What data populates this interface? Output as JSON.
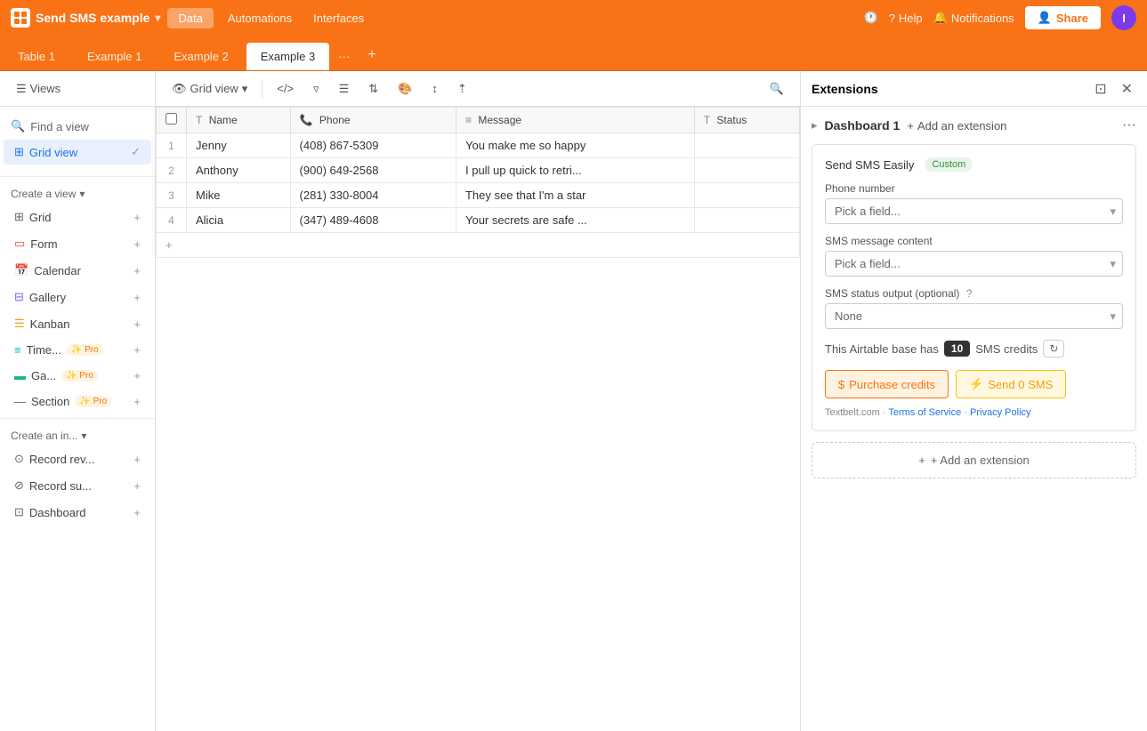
{
  "app": {
    "title": "Send SMS example",
    "logo_icon": "grid-icon"
  },
  "top_nav": {
    "data_label": "Data",
    "automations_label": "Automations",
    "interfaces_label": "Interfaces",
    "help_label": "Help",
    "notifications_label": "Notifications",
    "share_label": "Share",
    "avatar_initials": "I"
  },
  "tabs": [
    {
      "label": "Table 1",
      "active": false
    },
    {
      "label": "Example 1",
      "active": false
    },
    {
      "label": "Example 2",
      "active": false
    },
    {
      "label": "Example 3",
      "active": true
    }
  ],
  "toolbar": {
    "views_label": "Views",
    "grid_view_label": "Grid view",
    "search_placeholder": "Search"
  },
  "sidebar": {
    "find_view": "Find a view",
    "current_view": "Grid view",
    "create_view": "Create a view",
    "views": [
      {
        "label": "Grid",
        "icon": "grid-icon"
      },
      {
        "label": "Form",
        "icon": "form-icon"
      },
      {
        "label": "Calendar",
        "icon": "calendar-icon"
      },
      {
        "label": "Gallery",
        "icon": "gallery-icon"
      },
      {
        "label": "Kanban",
        "icon": "kanban-icon"
      },
      {
        "label": "Time...",
        "icon": "timeline-icon",
        "pro": true
      },
      {
        "label": "Ga...",
        "icon": "gantt-icon",
        "pro": true
      }
    ],
    "section_label": "Section",
    "section_pro": true,
    "create_interface_label": "Create an in...",
    "interfaces": [
      {
        "label": "Record rev...",
        "icon": "record-icon"
      },
      {
        "label": "Record su...",
        "icon": "record-icon"
      },
      {
        "label": "Dashboard",
        "icon": "dashboard-icon"
      }
    ]
  },
  "table": {
    "columns": [
      {
        "label": "Name",
        "icon": "text-icon"
      },
      {
        "label": "Phone",
        "icon": "phone-icon"
      },
      {
        "label": "Message",
        "icon": "message-icon"
      },
      {
        "label": "Status",
        "icon": "text-icon"
      }
    ],
    "rows": [
      {
        "id": 1,
        "name": "Jenny",
        "phone": "(408) 867-5309",
        "message": "You make me so happy",
        "status": ""
      },
      {
        "id": 2,
        "name": "Anthony",
        "phone": "(900) 649-2568",
        "message": "I pull up quick to retri...",
        "status": ""
      },
      {
        "id": 3,
        "name": "Mike",
        "phone": "(281) 330-8004",
        "message": "They see that I'm a star",
        "status": ""
      },
      {
        "id": 4,
        "name": "Alicia",
        "phone": "(347) 489-4608",
        "message": "Your secrets are safe ...",
        "status": ""
      }
    ]
  },
  "extensions": {
    "panel_title": "Extensions",
    "dashboard_title": "Dashboard 1",
    "add_extension_label": "Add an extension",
    "card": {
      "brand_label": "Send SMS Easily",
      "custom_label": "Custom",
      "phone_number_label": "Phone number",
      "phone_placeholder": "Pick a field...",
      "sms_content_label": "SMS message content",
      "sms_placeholder": "Pick a field...",
      "sms_status_label": "SMS status output (optional)",
      "status_default": "None",
      "credits_text": "This Airtable base has",
      "credits_count": "10",
      "credits_suffix": "SMS credits",
      "purchase_label": "Purchase credits",
      "send_label": "Send 0 SMS",
      "footer_text": "Textbelt.com ·",
      "terms_label": "Terms of Service",
      "privacy_label": "Privacy Policy"
    },
    "add_ext_footer": "+ Add an extension"
  }
}
